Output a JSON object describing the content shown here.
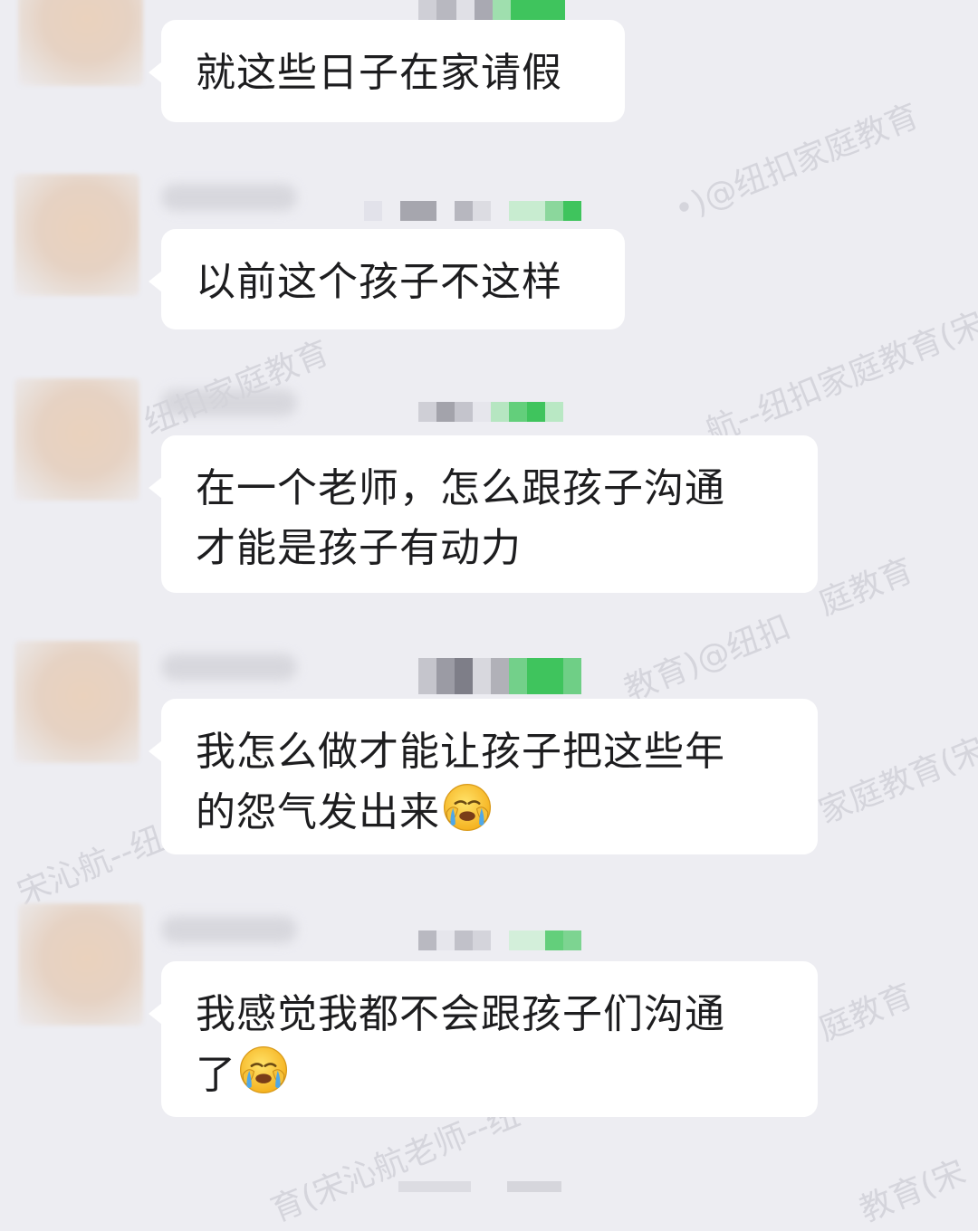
{
  "messages": [
    {
      "text": "就这些日子在家请假",
      "emoji": ""
    },
    {
      "text": "以前这个孩子不这样",
      "emoji": ""
    },
    {
      "line1": "在一个老师，怎么跟孩子沟通",
      "line2": "才能是孩子有动力",
      "emoji": ""
    },
    {
      "line1": "我怎么做才能让孩子把这些年",
      "line2": "的怨气发出来",
      "emoji": "face-crying-icon"
    },
    {
      "line1": "我感觉我都不会跟孩子们沟通",
      "line2": "了",
      "emoji": "face-crying-icon"
    }
  ],
  "watermarks": [
    "•)@纽扣家庭教育",
    "纽扣家庭教育",
    "航--纽扣家庭教育(宋",
    "庭教育",
    "教育)@纽扣",
    "家庭教育(宋",
    "宋沁航--纽",
    "庭教育",
    "育(宋沁航老师--纽",
    "教育(宋"
  ],
  "colors": {
    "background": "#ededf2",
    "bubble": "#ffffff",
    "text": "#1d1d1f",
    "blur_green": "#3fc45d"
  }
}
